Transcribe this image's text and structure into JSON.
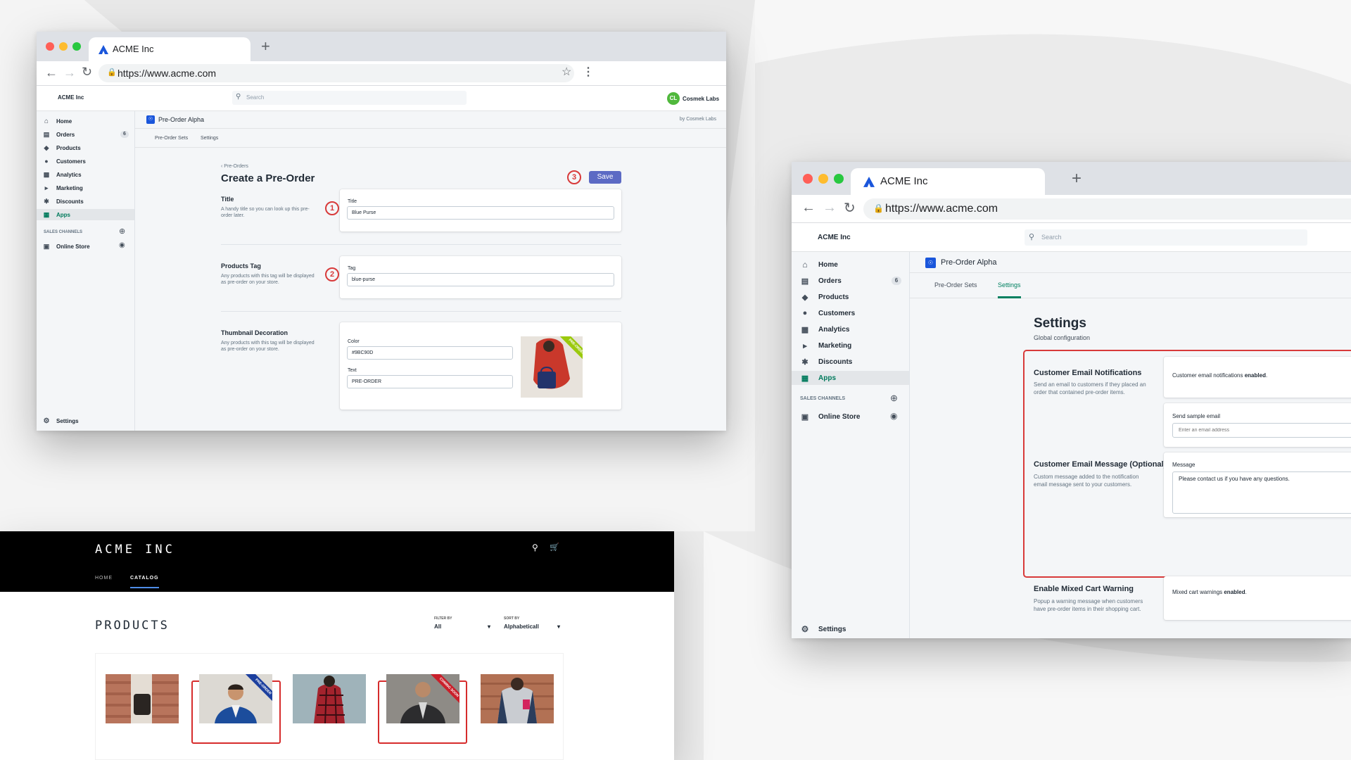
{
  "win1": {
    "tab_title": "ACME Inc",
    "new_tab": "+",
    "url": "https://www.acme.com",
    "store_name": "ACME Inc",
    "search_placeholder": "Search",
    "user_initials": "CL",
    "user_name": "Cosmek Labs",
    "nav": [
      {
        "label": "Home",
        "icon": "home-icon"
      },
      {
        "label": "Orders",
        "icon": "orders-icon",
        "badge": "6"
      },
      {
        "label": "Products",
        "icon": "tag-icon"
      },
      {
        "label": "Customers",
        "icon": "person-icon"
      },
      {
        "label": "Analytics",
        "icon": "bar-chart-icon"
      },
      {
        "label": "Marketing",
        "icon": "megaphone-icon"
      },
      {
        "label": "Discounts",
        "icon": "discount-icon"
      },
      {
        "label": "Apps",
        "icon": "apps-icon",
        "active": true
      }
    ],
    "sales_channels_label": "SALES CHANNELS",
    "online_store": "Online Store",
    "settings": "Settings",
    "app_name": "Pre-Order Alpha",
    "by": "by Cosmek Labs",
    "tabs": [
      "Pre-Order Sets",
      "Settings"
    ],
    "breadcrumb": "Pre-Orders",
    "page_title": "Create a Pre-Order",
    "save_label": "Save",
    "callouts": [
      "1",
      "2",
      "3"
    ],
    "sections": {
      "title": {
        "heading": "Title",
        "help": "A handy title so you can look up this pre-order later.",
        "field_label": "Title",
        "value": "Blue Purse"
      },
      "tag": {
        "heading": "Products Tag",
        "help": "Any products with this tag will be displayed as pre-order on your store.",
        "field_label": "Tag",
        "value": "blue-purse"
      },
      "thumb": {
        "heading": "Thumbnail Decoration",
        "help": "Any products with this tag will be displayed as pre-order on your store.",
        "color_label": "Color",
        "color_value": "#9BC90D",
        "text_label": "Text",
        "text_value": "PRE-ORDER",
        "ribbon": "PRE-ORDER"
      }
    }
  },
  "win2": {
    "tab_title": "ACME Inc",
    "new_tab": "+",
    "url": "https://www.acme.com",
    "store_name": "ACME Inc",
    "search_placeholder": "Search",
    "nav": [
      {
        "label": "Home"
      },
      {
        "label": "Orders",
        "badge": "6"
      },
      {
        "label": "Products"
      },
      {
        "label": "Customers"
      },
      {
        "label": "Analytics"
      },
      {
        "label": "Marketing"
      },
      {
        "label": "Discounts"
      },
      {
        "label": "Apps",
        "active": true
      }
    ],
    "sales_channels_label": "SALES CHANNELS",
    "online_store": "Online Store",
    "settings": "Settings",
    "app_name": "Pre-Order Alpha",
    "tabs": [
      "Pre-Order Sets",
      "Settings"
    ],
    "page_title": "Settings",
    "page_subtitle": "Global configuration",
    "notif": {
      "heading": "Customer Email Notifications",
      "help": "Send an email to customers if they placed an order that contained pre-order items.",
      "status_prefix": "Customer email notifications ",
      "status_strong": "enabled",
      "status_suffix": ".",
      "sample_label": "Send sample email",
      "sample_placeholder": "Enter an email address"
    },
    "message": {
      "heading": "Customer Email Message (Optional)",
      "help": "Custom message added to the notification email message sent to your customers.",
      "field_label": "Message",
      "value": "Please contact us if you have any questions."
    },
    "mixed": {
      "heading": "Enable Mixed Cart Warning",
      "help": "Popup a warning message when customers have pre-order items in their shopping cart.",
      "status_prefix": "Mixed cart warnings ",
      "status_strong": "enabled",
      "status_suffix": "."
    }
  },
  "store": {
    "logo": "ACME INC",
    "menu": [
      "HOME",
      "CATALOG"
    ],
    "heading": "PRODUCTS",
    "filter_label": "FILTER BY",
    "filter_value": "All",
    "sort_label": "SORT BY",
    "sort_value": "Alphabeticall",
    "ribbons": [
      "PRE-ORDER",
      "COMING SOON"
    ]
  },
  "colors": {
    "brand": "#5c6ac4",
    "accent_green": "#007a5c",
    "callout_red": "#d83a3a",
    "ribbon_green": "#9BC90D",
    "ribbon_blue": "#1c3f9e",
    "ribbon_red": "#c9202b"
  }
}
